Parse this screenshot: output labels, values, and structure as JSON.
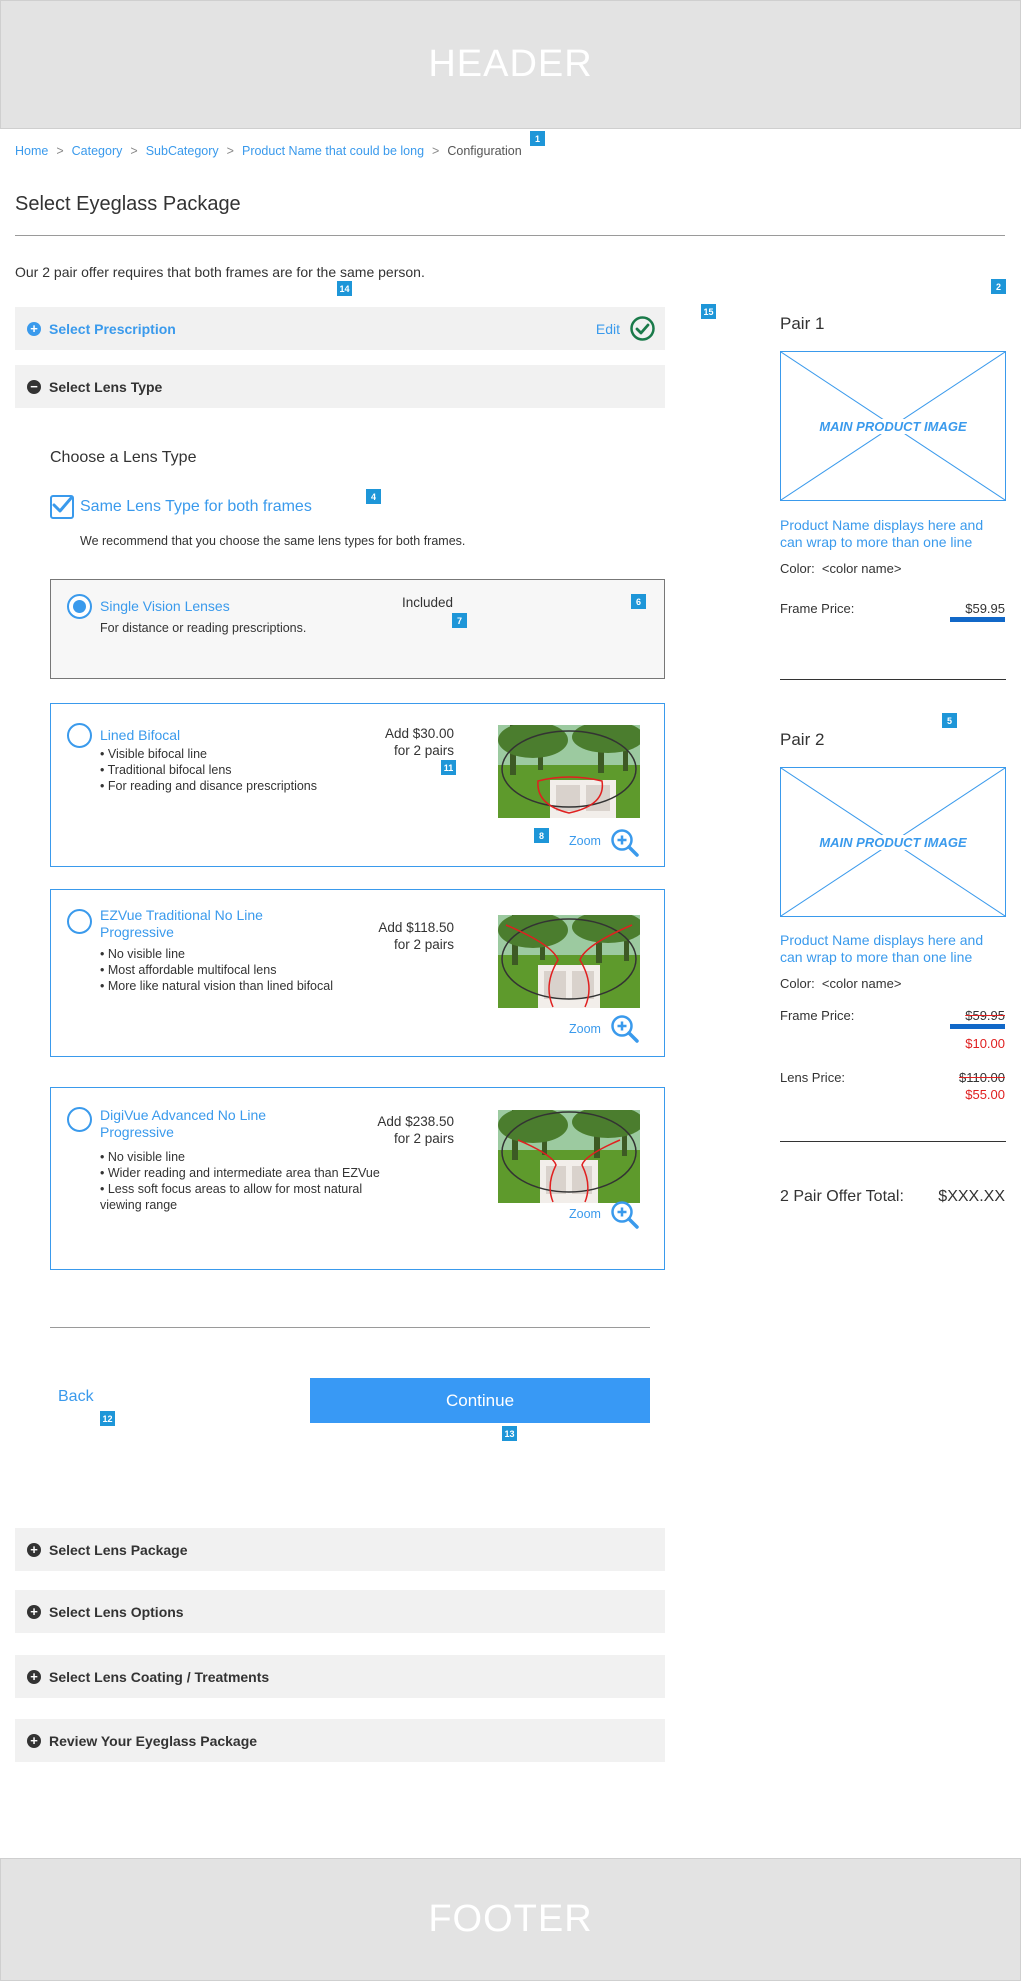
{
  "header": {
    "label": "HEADER"
  },
  "footer": {
    "label": "FOOTER"
  },
  "breadcrumb": {
    "items": [
      "Home",
      "Category",
      "SubCategory",
      "Product Name that could be long"
    ],
    "separator": ">",
    "current": "Configuration"
  },
  "page_title": "Select Eyeglass Package",
  "offer_note": "Our 2 pair offer requires that both frames are for the same person.",
  "prescription": {
    "label": "Select Prescription",
    "edit_label": "Edit",
    "complete": true
  },
  "lens_type": {
    "bar_label": "Select Lens Type",
    "heading": "Choose a Lens Type",
    "same_lens_label": "Same Lens Type for both frames",
    "same_lens_checked": true,
    "recommendation": "We recommend that you choose the same lens types for both frames.",
    "options": [
      {
        "name": "Single Vision Lenses",
        "description": "For distance or reading prescriptions.",
        "price": "Included",
        "selected": true
      },
      {
        "name": "Lined Bifocal",
        "bullets": [
          "Visible bifocal line",
          "Traditional bifocal lens",
          "For reading and disance prescriptions"
        ],
        "price_line1": "Add $30.00",
        "price_line2": "for 2 pairs",
        "zoom_label": "Zoom",
        "selected": false
      },
      {
        "name_line1": "EZVue Traditional No Line",
        "name_line2": "Progressive",
        "bullets": [
          "No visible line",
          "Most affordable multifocal lens",
          "More like natural vision than lined bifocal"
        ],
        "price_line1": "Add $118.50",
        "price_line2": "for 2 pairs",
        "zoom_label": "Zoom",
        "selected": false
      },
      {
        "name_line1": "DigiVue Advanced No Line",
        "name_line2": "Progressive",
        "bullets": [
          "No visible line",
          "Wider reading and intermediate area than EZVue",
          "Less soft focus areas to allow for most natural viewing range"
        ],
        "price_line1": "Add $238.50",
        "price_line2": "for 2 pairs",
        "zoom_label": "Zoom",
        "selected": false
      }
    ]
  },
  "actions": {
    "back_label": "Back",
    "continue_label": "Continue"
  },
  "collapsed_sections": [
    "Select Lens Package",
    "Select Lens Options",
    "Select Lens Coating / Treatments",
    "Review Your Eyeglass Package"
  ],
  "summary": {
    "pair1": {
      "title": "Pair 1",
      "image_label": "MAIN PRODUCT IMAGE",
      "product_name": "Product Name displays here and can wrap to more than one line",
      "color_label": "Color:",
      "color_value": "<color name>",
      "frame_price_label": "Frame Price:",
      "frame_price": "$59.95"
    },
    "pair2": {
      "title": "Pair 2",
      "image_label": "MAIN PRODUCT IMAGE",
      "product_name": "Product Name displays here and can wrap to more than one line",
      "color_label": "Color:",
      "color_value": "<color name>",
      "frame_price_label": "Frame Price:",
      "frame_price_original": "$59.95",
      "frame_price_sale": "$10.00",
      "lens_price_label": "Lens Price:",
      "lens_price_original": "$110.00",
      "lens_price_sale": "$55.00"
    },
    "total_label": "2 Pair Offer Total:",
    "total_value": "$XXX.XX"
  },
  "annotations": [
    "1",
    "2",
    "4",
    "5",
    "6",
    "7",
    "8",
    "11",
    "12",
    "13",
    "14",
    "15"
  ],
  "colors": {
    "accent": "#3a9aec",
    "primary_button": "#3899f5",
    "sale_red": "#e02020",
    "badge": "#1e96d8",
    "success_green": "#1a7a4a"
  }
}
